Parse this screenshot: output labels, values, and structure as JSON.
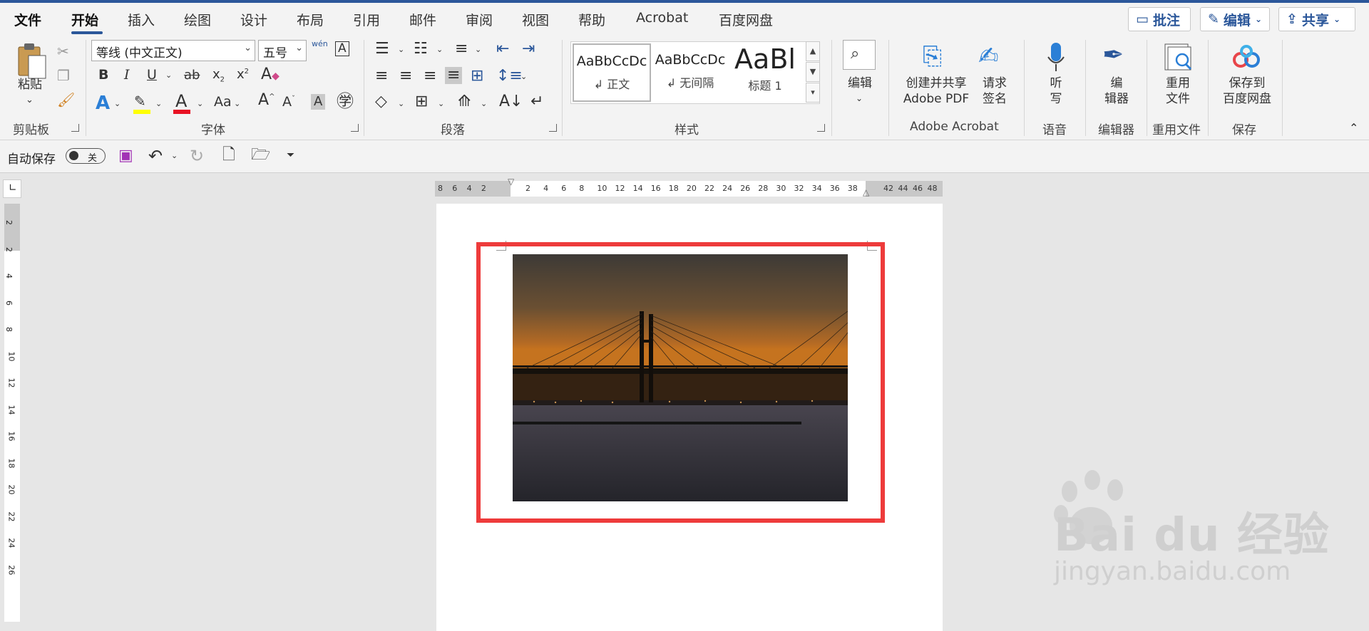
{
  "tabs": [
    "文件",
    "开始",
    "插入",
    "绘图",
    "设计",
    "布局",
    "引用",
    "邮件",
    "审阅",
    "视图",
    "帮助",
    "Acrobat",
    "百度网盘"
  ],
  "active_tab": "开始",
  "top_buttons": {
    "comment": "批注",
    "edit": "编辑",
    "share": "共享"
  },
  "clipboard": {
    "paste": "粘贴",
    "group": "剪贴板"
  },
  "font": {
    "name": "等线 (中文正文)",
    "size": "五号",
    "phonetic": "wén",
    "group": "字体",
    "bold": "B",
    "italic": "I",
    "underline": "U",
    "strike": "ab",
    "sub": "x",
    "sup": "x",
    "case": "Aa",
    "grow": "A",
    "shrink": "A"
  },
  "paragraph": {
    "group": "段落"
  },
  "styles": {
    "group": "样式",
    "items": [
      {
        "sample": "AaBbCcDc",
        "name": "↲ 正文"
      },
      {
        "sample": "AaBbCcDc",
        "name": "↲ 无间隔"
      },
      {
        "sample": "AaBl",
        "name": "标题 1"
      }
    ]
  },
  "editing": {
    "label": "编辑"
  },
  "acrobat": {
    "create_line1": "创建并共享",
    "create_line2": "Adobe PDF",
    "sign_line1": "请求",
    "sign_line2": "签名",
    "group": "Adobe Acrobat"
  },
  "voice": {
    "line1": "听",
    "line2": "写",
    "group": "语音"
  },
  "editor": {
    "line1": "编",
    "line2": "辑器",
    "group": "编辑器"
  },
  "reuse": {
    "line1": "重用",
    "line2": "文件",
    "group": "重用文件"
  },
  "save": {
    "line1": "保存到",
    "line2": "百度网盘",
    "group": "保存"
  },
  "qat": {
    "autosave": "自动保存",
    "toggle": "关"
  },
  "hruler_left": [
    "8",
    "6",
    "4",
    "2"
  ],
  "hruler_mid": [
    "2",
    "4",
    "6",
    "8",
    "10",
    "12",
    "14",
    "16",
    "18",
    "20",
    "22",
    "24",
    "26",
    "28",
    "30",
    "32",
    "34",
    "36",
    "38"
  ],
  "hruler_right": [
    "42",
    "44",
    "46",
    "48"
  ],
  "vruler_nums": [
    "2",
    "2",
    "4",
    "6",
    "8",
    "10",
    "12",
    "14",
    "16",
    "18",
    "20",
    "22",
    "24",
    "26"
  ],
  "watermark": {
    "text": "Bai du 经验",
    "url": "jingyan.baidu.com"
  },
  "colors": {
    "accent": "#2b579a",
    "highlight": "#ffff00",
    "font_color": "#e81123",
    "annotation": "#ee3b3b"
  }
}
